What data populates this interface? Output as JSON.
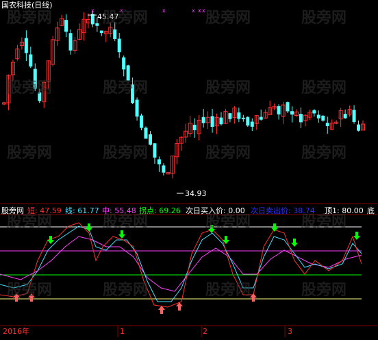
{
  "header": {
    "title": "国农科技(日线)"
  },
  "price_panel": {
    "high_label": "45.47",
    "low_label": "34.93"
  },
  "indicator_bar": {
    "name": "股旁网",
    "items": [
      {
        "label": "短: 47.59",
        "color": "#ff3030"
      },
      {
        "label": "线: 61.77",
        "color": "#40e0ff"
      },
      {
        "label": "中: 55.48",
        "color": "#ff40ff"
      },
      {
        "label": "拐点: 69.26",
        "color": "#00ff00"
      },
      {
        "label": "次日买入价: 0.00",
        "color": "#ffffff"
      },
      {
        "label": "次日卖出价: 38.74",
        "color": "#3030ff"
      },
      {
        "label": "顶1: 80.00",
        "color": "#ffffff"
      },
      {
        "label": "底",
        "color": "#ffffff"
      }
    ]
  },
  "time_axis": {
    "labels": [
      "2016年",
      "1",
      "2",
      "3"
    ]
  },
  "watermark": "股旁网",
  "colors": {
    "up": "#ff3030",
    "down": "#54ffff",
    "grid": "#800000"
  }
}
